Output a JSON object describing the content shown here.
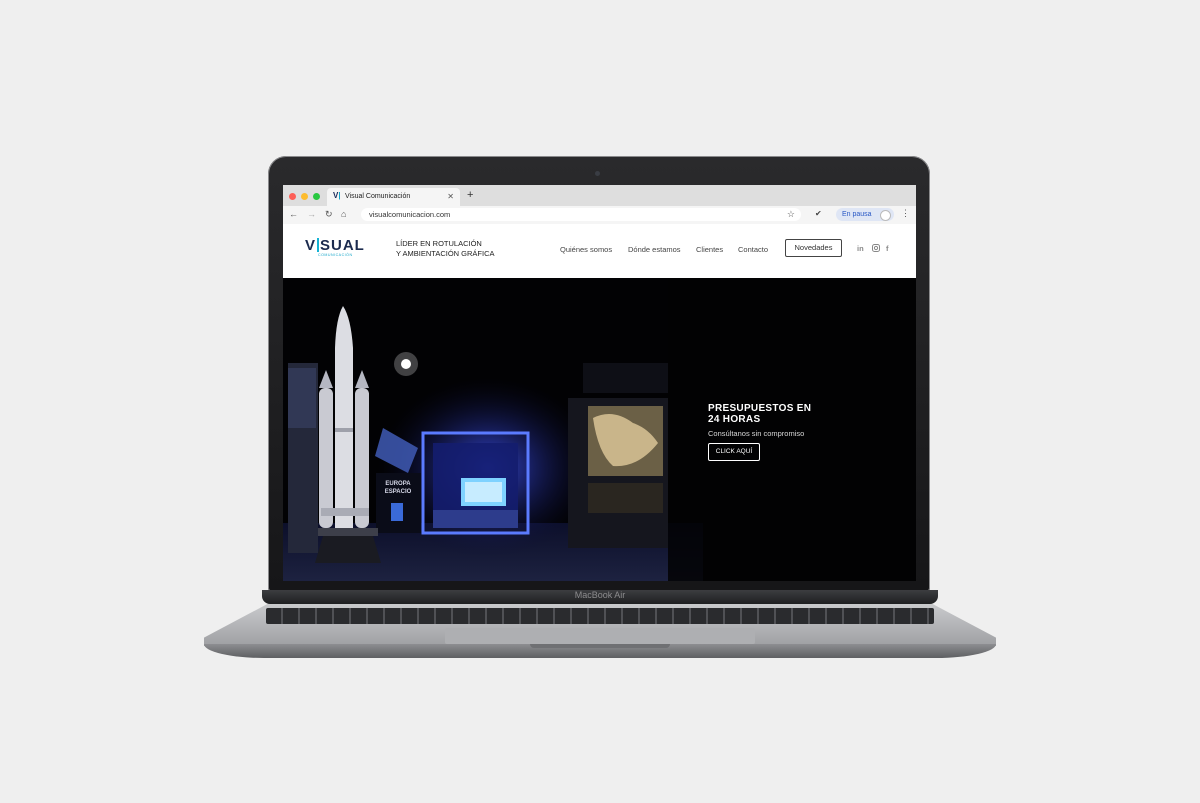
{
  "device": {
    "brand_label": "MacBook Air"
  },
  "browser": {
    "tab_title": "Visual Comunicación",
    "favicon_text": "V",
    "url": "visualcomunicacion.com",
    "profile_status": "En pausa"
  },
  "site": {
    "logo": {
      "word_start": "V",
      "word_end": "SUAL",
      "subtitle": "COMUNICACIÓN"
    },
    "tagline_line1": "LÍDER EN ROTULACIÓN",
    "tagline_line2": "Y AMBIENTACIÓN GRÁFICA",
    "nav": [
      "Quiénes somos",
      "Dónde estamos",
      "Clientes",
      "Contacto"
    ],
    "novedades_label": "Novedades",
    "social": {
      "linkedin": "in",
      "facebook": "f"
    }
  },
  "hero": {
    "cta_title_line1": "PRESUPUESTOS EN",
    "cta_title_line2": "24 HORAS",
    "cta_subtitle": "Consúltanos sin compromiso",
    "cta_button": "CLICK AQUÍ",
    "sign_line1": "EUROPA",
    "sign_line2": "ESPACIO"
  },
  "colors": {
    "brand_navy": "#1b2a4e",
    "brand_cyan": "#14a5c9",
    "hero_background": "#020204"
  }
}
